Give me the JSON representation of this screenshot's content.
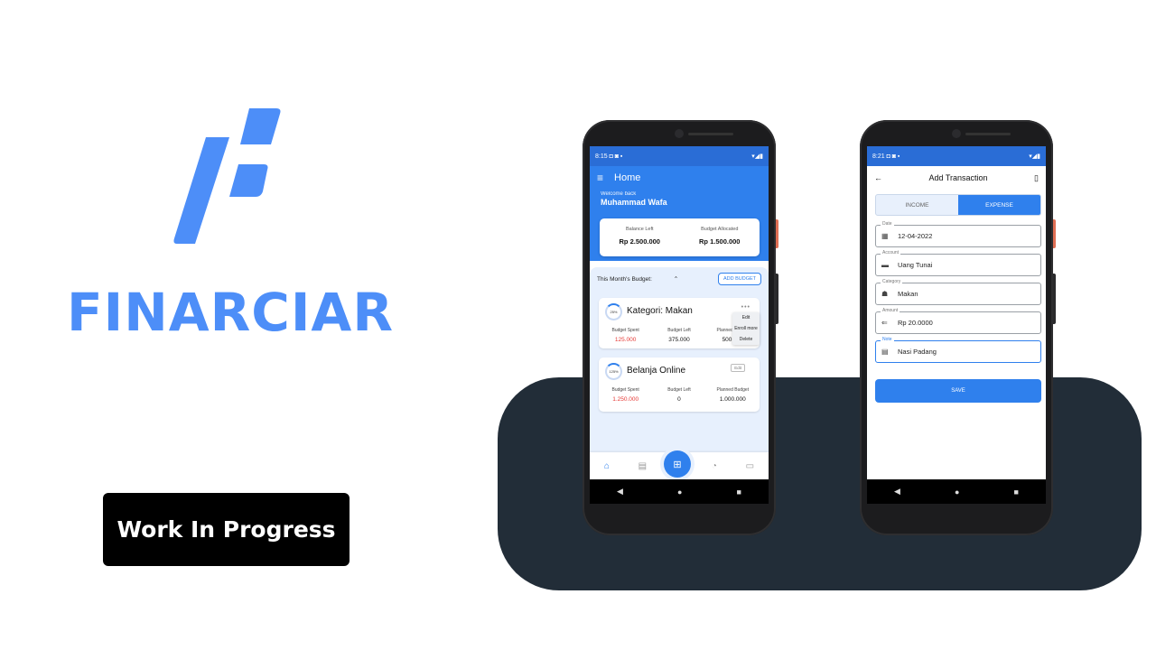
{
  "brand": {
    "name": "FINARCIAR",
    "color": "#4d8ef8",
    "logo_icon": "brand-f-icon"
  },
  "badge": {
    "label": "Work In Progress"
  },
  "phone_home": {
    "status": {
      "time": "8:15",
      "icons": "◘ ◙ ▪",
      "right": "▾◢▮"
    },
    "appbar": {
      "menu_icon": "≡",
      "title": "Home"
    },
    "welcome": "Welcome back",
    "user_name": "Muhammad Wafa",
    "balance": {
      "left_label": "Balance Left",
      "left_value": "Rp 2.500.000",
      "alloc_label": "Budget Allocated",
      "alloc_value": "Rp 1.500.000"
    },
    "budget_header": {
      "title": "This Month's Budget",
      "chevron": "⌃",
      "add_label": "ADD BUDGET"
    },
    "cards": [
      {
        "percent": "25%",
        "title": "Kategori: Makan",
        "dots": "•••",
        "stats": [
          {
            "label": "Budget Spent",
            "value": "125.000"
          },
          {
            "label": "Budget Left",
            "value": "375.000"
          },
          {
            "label": "Planned Budget",
            "value": "500.000"
          }
        ],
        "menu": [
          "Edit",
          "Enroll more",
          "Delete"
        ]
      },
      {
        "percent": "125%",
        "title": "Belanja Online",
        "edit_label": "Edit",
        "stats": [
          {
            "label": "Budget Spent",
            "value": "1.250.000"
          },
          {
            "label": "Budget Left",
            "value": "0"
          },
          {
            "label": "Planned Budget",
            "value": "1.000.000"
          }
        ]
      }
    ],
    "bottom_nav": [
      "⌂",
      "▤",
      "◔",
      "▭"
    ],
    "fab_icon": "⊞",
    "sys_nav": [
      "◀",
      "●",
      "■"
    ]
  },
  "phone_add": {
    "status": {
      "time": "8:21",
      "icons": "◘ ◙ ▪",
      "right": "▾◢▮"
    },
    "topbar": {
      "back": "←",
      "title": "Add Transaction",
      "bookmark": "▯"
    },
    "tabs": [
      "INCOME",
      "EXPENSE"
    ],
    "fields": [
      {
        "label": "Date",
        "icon": "▦",
        "value": "12-04-2022"
      },
      {
        "label": "Account",
        "icon": "▬",
        "value": "Uang Tunai"
      },
      {
        "label": "Category",
        "icon": "☗",
        "value": "Makan"
      },
      {
        "label": "Amount",
        "icon": "⇐",
        "value": "Rp 20.0000"
      },
      {
        "label": "Note",
        "icon": "▤",
        "value": "Nasi Padang"
      }
    ],
    "save_label": "SAVE",
    "sys_nav": [
      "◀",
      "●",
      "■"
    ]
  }
}
